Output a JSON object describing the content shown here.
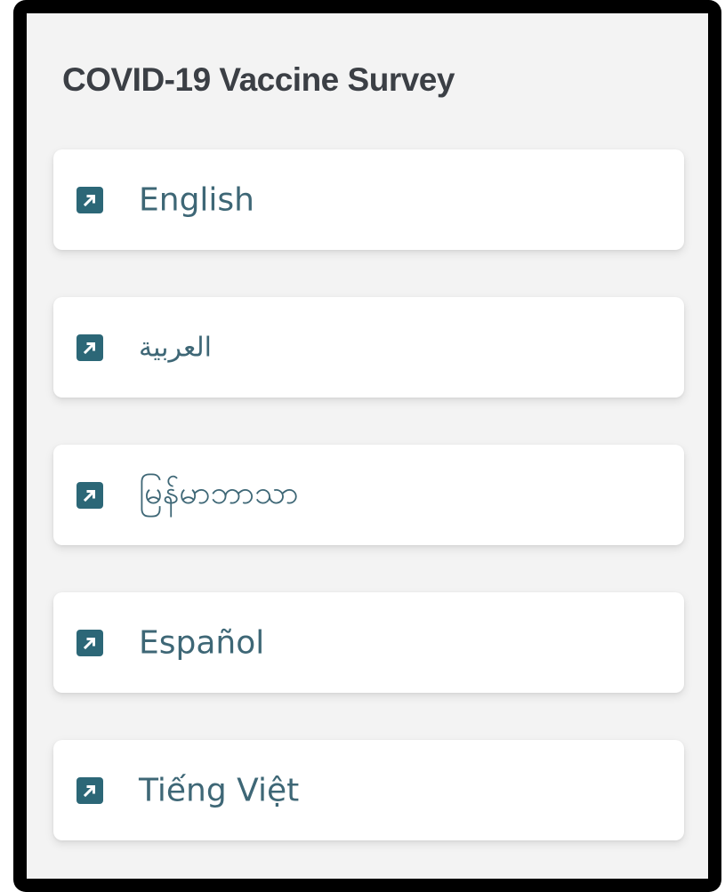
{
  "survey": {
    "title": "COVID-19 Vaccine Survey",
    "links": [
      {
        "label": "English",
        "icon": "external-link-icon"
      },
      {
        "label": "العربية",
        "icon": "external-link-icon"
      },
      {
        "label": "မြန်မာဘာသာ",
        "icon": "external-link-icon"
      },
      {
        "label": "Español",
        "icon": "external-link-icon"
      },
      {
        "label": "Tiếng Việt",
        "icon": "external-link-icon"
      }
    ]
  },
  "colors": {
    "icon": "#2c6777",
    "link_text": "#3e6776",
    "title": "#3b3f45",
    "panel_background": "#f3f3f3",
    "border": "#000000"
  }
}
